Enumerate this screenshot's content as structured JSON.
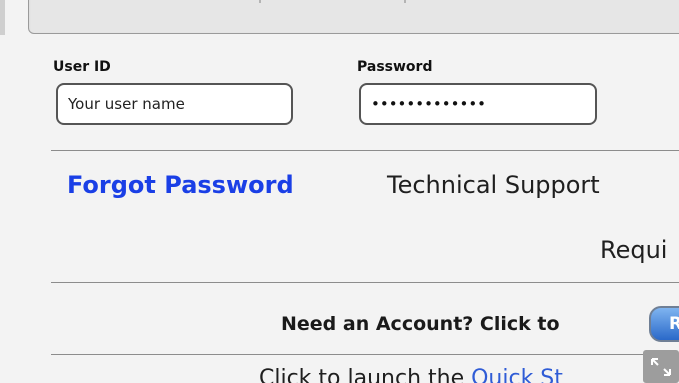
{
  "login": {
    "user_id_label": "User ID",
    "user_id_value": "Your user name",
    "password_label": "Password",
    "password_value": "•••••••••••••"
  },
  "links": {
    "forgot_password": "Forgot Password",
    "technical_support": "Technical Support",
    "required_partial": "Requi"
  },
  "account": {
    "prompt": "Need an Account? Click to",
    "register_button_partial": "R"
  },
  "footer": {
    "text_partial": "Click to launch the ",
    "link_partial": "Quick St"
  },
  "icons": {
    "expand": "expand-icon"
  },
  "colors": {
    "link_blue": "#1a3fe6",
    "button_blue": "#2a69c9"
  }
}
